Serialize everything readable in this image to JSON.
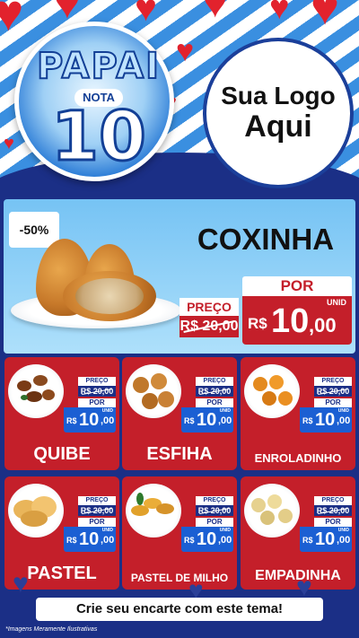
{
  "header": {
    "badge": {
      "top": "PAPAI",
      "nota": "NOTA",
      "number": "10"
    },
    "logo": {
      "line1": "Sua Logo",
      "line2": "Aqui"
    }
  },
  "featured": {
    "discount": "-50%",
    "name": "COXINHA",
    "old_label": "PREÇO",
    "old_price": "R$ 20,00",
    "new_label": "POR",
    "currency": "R$",
    "new_int": "10",
    "new_dec": ",00",
    "unit": "UNID"
  },
  "products": [
    {
      "name": "QUIBE",
      "old_label": "PREÇO",
      "old_price": "R$ 20,00",
      "new_label": "POR",
      "currency": "R$",
      "new_int": "10",
      "new_dec": ",00",
      "unit": "UNID"
    },
    {
      "name": "ESFIHA",
      "old_label": "PREÇO",
      "old_price": "R$ 20,00",
      "new_label": "POR",
      "currency": "R$",
      "new_int": "10",
      "new_dec": ",00",
      "unit": "UNID"
    },
    {
      "name": "ENROLADINHO",
      "old_label": "PREÇO",
      "old_price": "R$ 20,00",
      "new_label": "POR",
      "currency": "R$",
      "new_int": "10",
      "new_dec": ",00",
      "unit": "UNID"
    },
    {
      "name": "PASTEL",
      "old_label": "PREÇO",
      "old_price": "R$ 20,00",
      "new_label": "POR",
      "currency": "R$",
      "new_int": "10",
      "new_dec": ",00",
      "unit": "UNID"
    },
    {
      "name": "PASTEL DE MILHO",
      "old_label": "PREÇO",
      "old_price": "R$ 20,00",
      "new_label": "POR",
      "currency": "R$",
      "new_int": "10",
      "new_dec": ",00",
      "unit": "UNID"
    },
    {
      "name": "EMPADINHA",
      "old_label": "PREÇO",
      "old_price": "R$ 20,00",
      "new_label": "POR",
      "currency": "R$",
      "new_int": "10",
      "new_dec": ",00",
      "unit": "UNID"
    }
  ],
  "footer": {
    "cta": "Crie seu encarte com este tema!",
    "disclaimer": "*Imagens Meramente Ilustrativas"
  },
  "colors": {
    "background": "#1b2f86",
    "card_red": "#c41f2a",
    "price_blue": "#1b5fd3",
    "featured_bg": "#8fd0f8",
    "heart_red": "#e2222d"
  },
  "icons": [
    "heart-icon",
    "coxinha-image",
    "food-image"
  ]
}
